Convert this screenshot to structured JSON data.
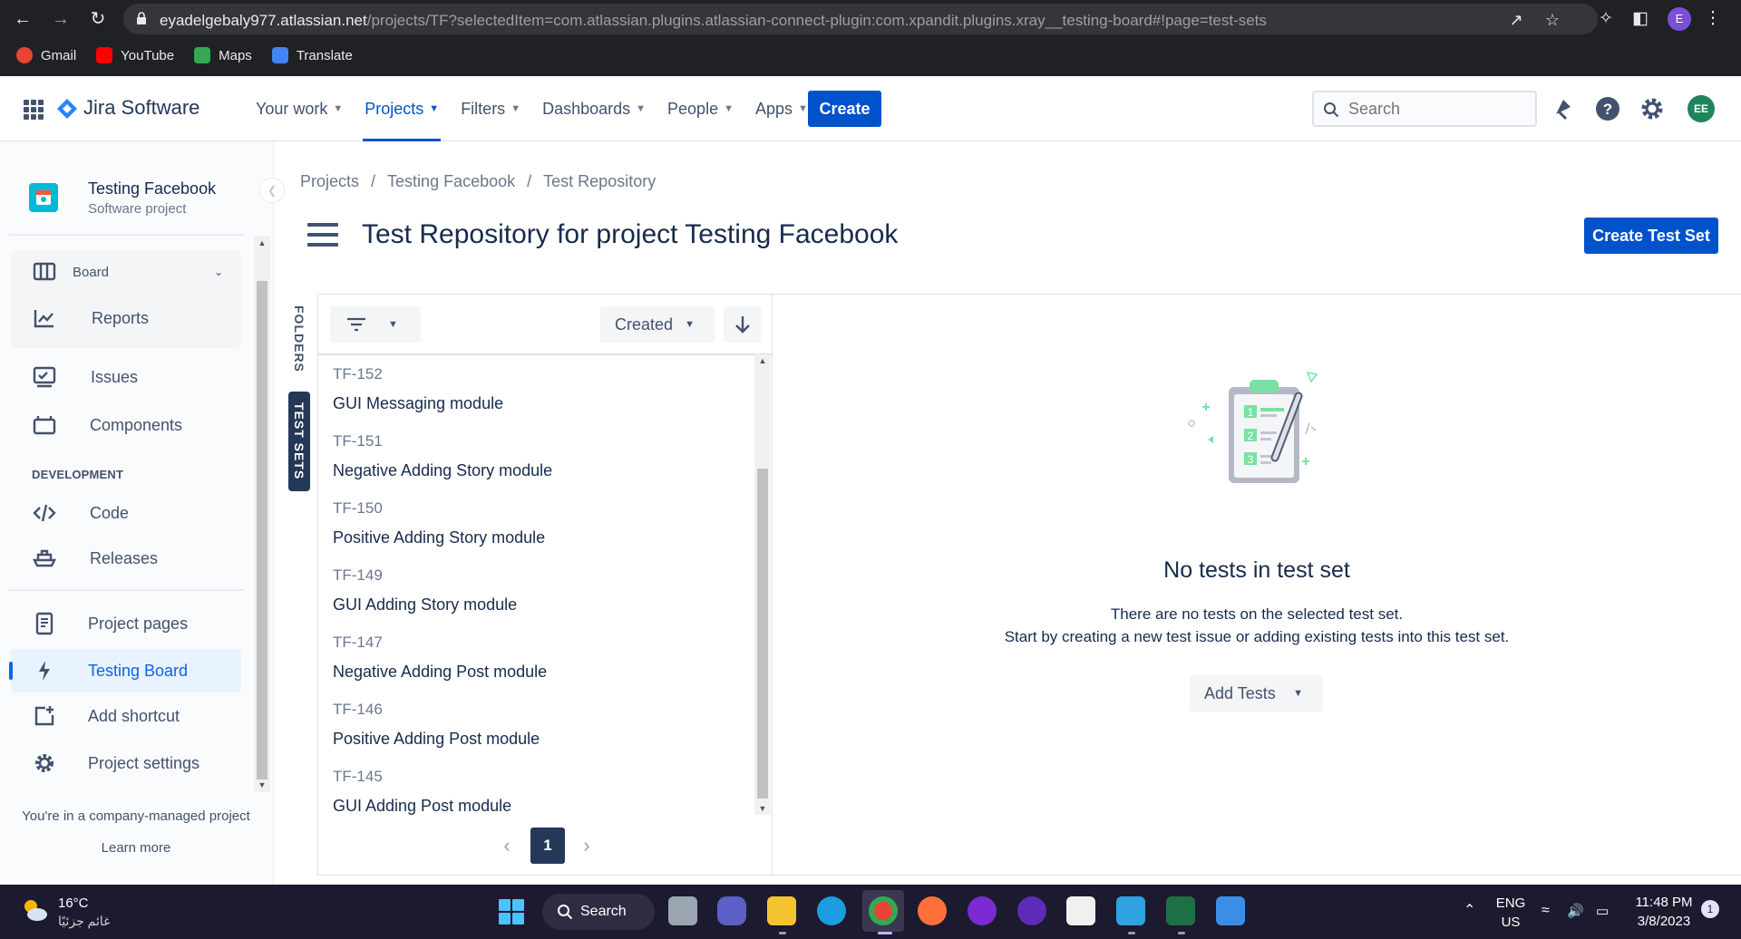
{
  "browser": {
    "url_host": "eyadelgebaly977.atlassian.net",
    "url_path": "/projects/TF?selectedItem=com.atlassian.plugins.atlassian-connect-plugin:com.xpandit.plugins.xray__testing-board#!page=test-sets",
    "profile_initial": "E",
    "bookmarks": [
      {
        "label": "Gmail",
        "icon": "gmail-icon",
        "color": "#ea4335"
      },
      {
        "label": "YouTube",
        "icon": "youtube-icon",
        "color": "#ff0000"
      },
      {
        "label": "Maps",
        "icon": "maps-icon",
        "color": "#34a853"
      },
      {
        "label": "Translate",
        "icon": "translate-icon",
        "color": "#4285f4"
      }
    ]
  },
  "header": {
    "product": "Jira Software",
    "nav": [
      {
        "label": "Your work",
        "active": false
      },
      {
        "label": "Projects",
        "active": true
      },
      {
        "label": "Filters",
        "active": false
      },
      {
        "label": "Dashboards",
        "active": false
      },
      {
        "label": "People",
        "active": false
      },
      {
        "label": "Apps",
        "active": false
      }
    ],
    "create_label": "Create",
    "search_placeholder": "Search",
    "avatar_initials": "EE",
    "brand_color": "#0052cc"
  },
  "sidebar": {
    "project_name": "Testing Facebook",
    "project_type": "Software project",
    "items": {
      "board": "Board",
      "reports": "Reports",
      "issues": "Issues",
      "components": "Components",
      "code": "Code",
      "releases": "Releases",
      "project_pages": "Project pages",
      "testing_board": "Testing Board",
      "add_shortcut": "Add shortcut",
      "project_settings": "Project settings"
    },
    "development_heading": "DEVELOPMENT",
    "footer_text": "You're in a company-managed project",
    "learn_more": "Learn more"
  },
  "main": {
    "breadcrumb": [
      "Projects",
      "Testing Facebook",
      "Test Repository"
    ],
    "title": "Test Repository for project Testing Facebook",
    "create_test_set": "Create Test Set",
    "tabs": {
      "folders": "FOLDERS",
      "test_sets": "TEST SETS"
    },
    "sort_label": "Created",
    "test_sets": [
      {
        "key": "TF-152",
        "name": "GUI Messaging module"
      },
      {
        "key": "TF-151",
        "name": "Negative Adding Story module"
      },
      {
        "key": "TF-150",
        "name": "Positive Adding Story module"
      },
      {
        "key": "TF-149",
        "name": "GUI Adding Story module"
      },
      {
        "key": "TF-147",
        "name": "Negative Adding Post module"
      },
      {
        "key": "TF-146",
        "name": "Positive Adding Post module"
      },
      {
        "key": "TF-145",
        "name": "GUI Adding Post module"
      }
    ],
    "current_page": "1",
    "empty_title": "No tests in test set",
    "empty_line1": "There are no tests on the selected test set.",
    "empty_line2": "Start by creating a new test issue or adding existing tests into this test set.",
    "add_tests": "Add Tests"
  },
  "taskbar": {
    "temperature": "16°C",
    "weather_condition": "غائم جزئيًا",
    "search_label": "Search",
    "language": "ENG",
    "region": "US",
    "time": "11:48 PM",
    "date": "3/8/2023",
    "notifications": "1"
  }
}
